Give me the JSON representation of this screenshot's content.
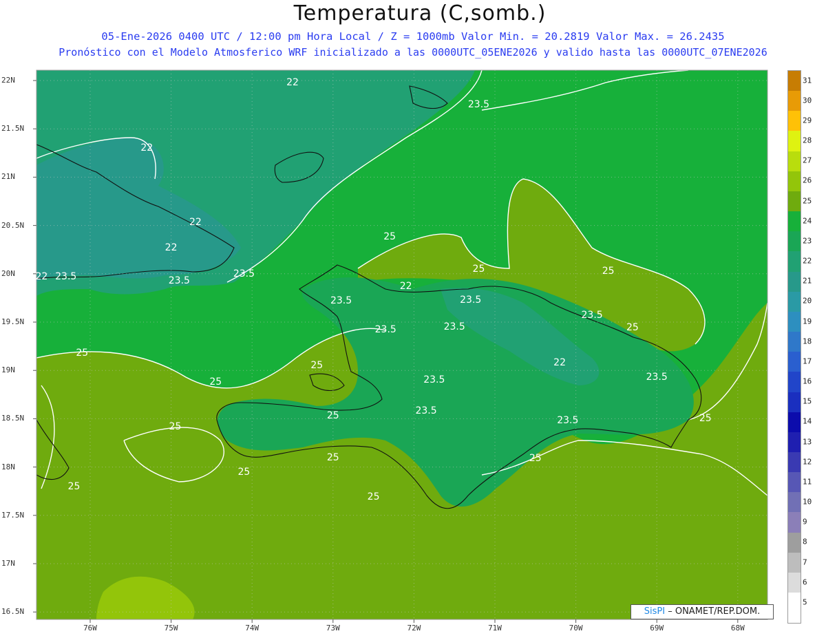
{
  "title": "Temperatura (C,somb.)",
  "subtitle_line1": "05-Ene-2026 0400 UTC / 12:00 pm Hora Local / Z = 1000mb  Valor Min. = 20.2819  Valor Max. = 26.2435",
  "subtitle_line2": "Pronóstico con el Modelo Atmosferico WRF inicializado a las 0000UTC_05ENE2026 y valido hasta las  0000UTC_07ENE2026",
  "axes": {
    "lat_labels": [
      "22N",
      "21.5N",
      "21N",
      "20.5N",
      "20N",
      "19.5N",
      "19N",
      "18.5N",
      "18N",
      "17.5N",
      "17N",
      "16.5N"
    ],
    "lon_labels": [
      "76W",
      "75W",
      "74W",
      "73W",
      "72W",
      "71W",
      "70W",
      "69W",
      "68W"
    ]
  },
  "contour_labels": [
    {
      "text": "22",
      "lon": -73.5,
      "lat": 21.98
    },
    {
      "text": "23.5",
      "lon": -71.2,
      "lat": 21.75
    },
    {
      "text": "22",
      "lon": -75.3,
      "lat": 21.3
    },
    {
      "text": "22",
      "lon": -74.7,
      "lat": 20.53
    },
    {
      "text": "22",
      "lon": -75.0,
      "lat": 20.27
    },
    {
      "text": "22",
      "lon": -76.6,
      "lat": 19.97
    },
    {
      "text": "23.5",
      "lon": -76.3,
      "lat": 19.97
    },
    {
      "text": "23.5",
      "lon": -74.9,
      "lat": 19.93
    },
    {
      "text": "23.5",
      "lon": -74.1,
      "lat": 20.0
    },
    {
      "text": "25",
      "lon": -72.3,
      "lat": 20.38
    },
    {
      "text": "25",
      "lon": -71.2,
      "lat": 20.05
    },
    {
      "text": "25",
      "lon": -69.6,
      "lat": 20.03
    },
    {
      "text": "22",
      "lon": -72.1,
      "lat": 19.87
    },
    {
      "text": "23.5",
      "lon": -72.9,
      "lat": 19.72
    },
    {
      "text": "23.5",
      "lon": -71.3,
      "lat": 19.73
    },
    {
      "text": "23.5",
      "lon": -72.35,
      "lat": 19.42
    },
    {
      "text": "23.5",
      "lon": -71.5,
      "lat": 19.45
    },
    {
      "text": "23.5",
      "lon": -69.8,
      "lat": 19.57
    },
    {
      "text": "25",
      "lon": -69.3,
      "lat": 19.44
    },
    {
      "text": "25",
      "lon": -76.1,
      "lat": 19.18
    },
    {
      "text": "25",
      "lon": -73.2,
      "lat": 19.05
    },
    {
      "text": "22",
      "lon": -70.2,
      "lat": 19.08
    },
    {
      "text": "25",
      "lon": -74.45,
      "lat": 18.88
    },
    {
      "text": "23.5",
      "lon": -71.75,
      "lat": 18.9
    },
    {
      "text": "23.5",
      "lon": -69.0,
      "lat": 18.93
    },
    {
      "text": "23.5",
      "lon": -71.85,
      "lat": 18.58
    },
    {
      "text": "25",
      "lon": -73.0,
      "lat": 18.53
    },
    {
      "text": "23.5",
      "lon": -70.1,
      "lat": 18.48
    },
    {
      "text": "25",
      "lon": -68.4,
      "lat": 18.5
    },
    {
      "text": "25",
      "lon": -74.95,
      "lat": 18.42
    },
    {
      "text": "25",
      "lon": -73.0,
      "lat": 18.1
    },
    {
      "text": "25",
      "lon": -70.5,
      "lat": 18.09
    },
    {
      "text": "25",
      "lon": -74.1,
      "lat": 17.95
    },
    {
      "text": "25",
      "lon": -76.2,
      "lat": 17.8
    },
    {
      "text": "25",
      "lon": -72.5,
      "lat": 17.69
    }
  ],
  "legend": {
    "levels": [
      "5",
      "6",
      "7",
      "8",
      "9",
      "10",
      "11",
      "12",
      "13",
      "14",
      "15",
      "16",
      "17",
      "18",
      "19",
      "20",
      "21",
      "22",
      "23",
      "24",
      "25",
      "26",
      "27",
      "28",
      "29",
      "30",
      "31"
    ],
    "colors": [
      "#ffffff",
      "#dcdcdc",
      "#bdbdbd",
      "#9e9e9e",
      "#8b7fb8",
      "#7170b5",
      "#5757b5",
      "#3a3ab2",
      "#1f1fb0",
      "#0c0cac",
      "#1a2fbf",
      "#2145c9",
      "#2a5fcf",
      "#2f78c9",
      "#2d8fbf",
      "#2a9aa5",
      "#27998a",
      "#21a173",
      "#1aa655",
      "#17b03a",
      "#6fab0e",
      "#93c50a",
      "#b9dd0d",
      "#dff211",
      "#ffc107",
      "#e89b06",
      "#c77d03"
    ]
  },
  "credit": {
    "brand": "SisPI",
    "text": " – ONAMET/REP.DOM."
  }
}
